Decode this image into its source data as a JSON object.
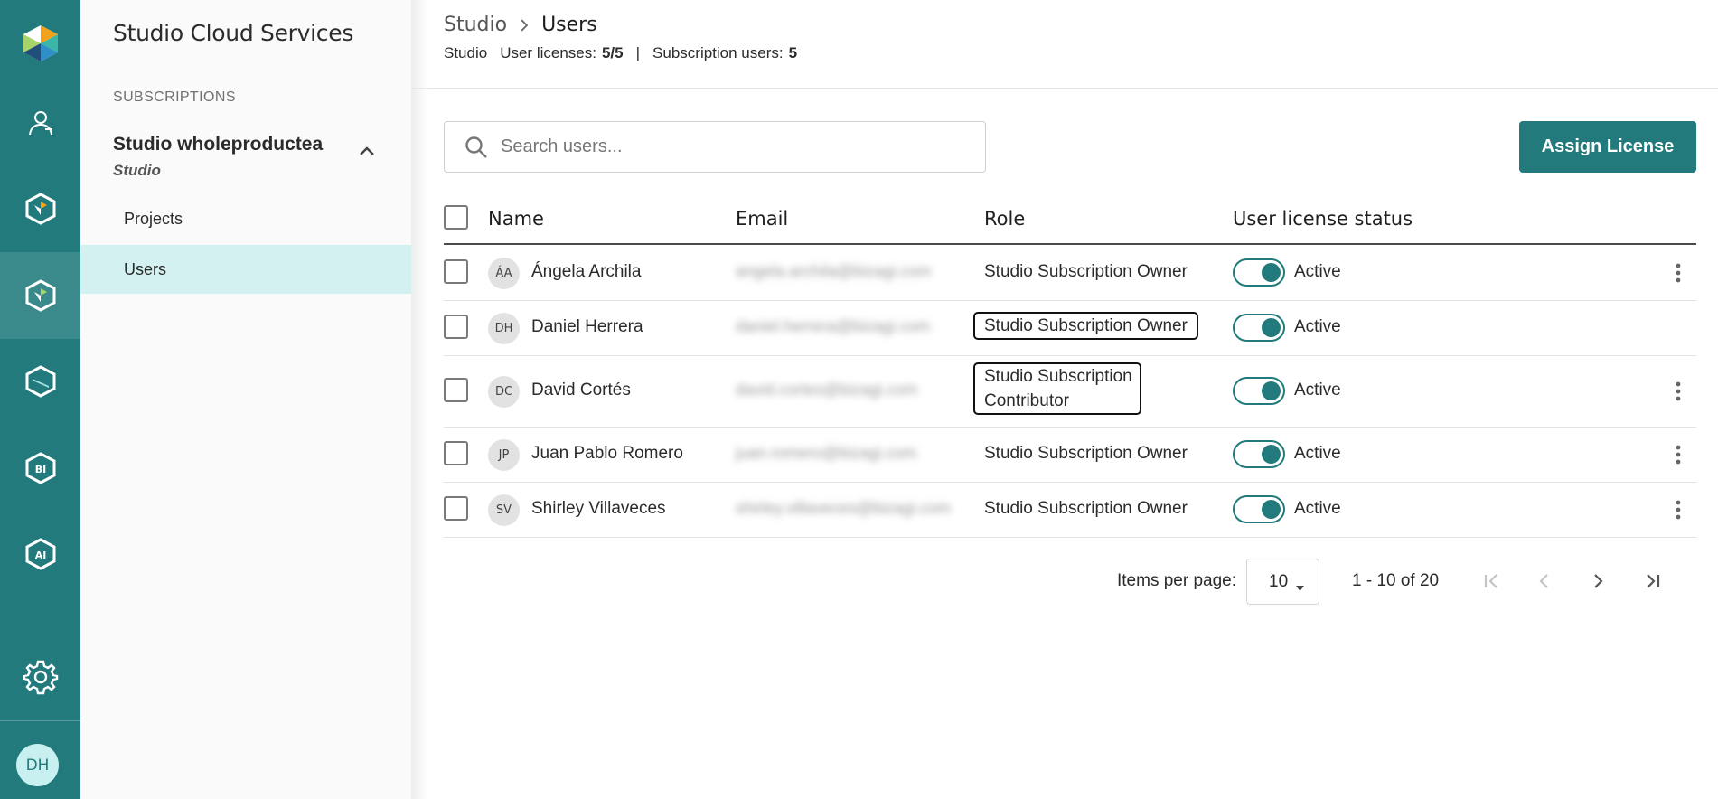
{
  "rail": {
    "items": [
      {
        "name": "studio-logo-icon",
        "label": "Studio logo"
      },
      {
        "name": "users-icon",
        "label": "Users"
      },
      {
        "name": "modeler-icon",
        "label": "Modeler"
      },
      {
        "name": "cloud-services-icon",
        "label": "Cloud services"
      },
      {
        "name": "cube-icon",
        "label": "Cube"
      },
      {
        "name": "bi-icon",
        "label": "BI"
      },
      {
        "name": "ai-icon",
        "label": "AI"
      }
    ],
    "settings_icon": "gear-icon",
    "avatar_initials": "DH"
  },
  "nav": {
    "title": "Studio Cloud Services",
    "section_label": "SUBSCRIPTIONS",
    "subscription_name": "Studio wholeproductea",
    "subscription_type": "Studio",
    "items": [
      {
        "label": "Projects",
        "active": false
      },
      {
        "label": "Users",
        "active": true
      }
    ]
  },
  "header": {
    "breadcrumb": [
      "Studio",
      "Users"
    ],
    "meta": {
      "product": "Studio",
      "licenses_label": "User licenses:",
      "licenses_value": "5/5",
      "separator": "|",
      "subscription_users_label": "Subscription users:",
      "subscription_users_value": "5"
    }
  },
  "toolbar": {
    "search_placeholder": "Search users...",
    "assign_label": "Assign License"
  },
  "table": {
    "columns": [
      "Name",
      "Email",
      "Role",
      "User license status"
    ],
    "rows": [
      {
        "initials": "ÁA",
        "name": "Ángela Archila",
        "email": "angela.archila@bizagi.com",
        "role_line1": "Studio Subscription Owner",
        "role_line2": "",
        "status": "Active",
        "highlighted": false,
        "has_menu": true
      },
      {
        "initials": "DH",
        "name": "Daniel Herrera",
        "email": "daniel.herrera@bizagi.com",
        "role_line1": "Studio Subscription Owner",
        "role_line2": "",
        "status": "Active",
        "highlighted": true,
        "has_menu": false
      },
      {
        "initials": "DC",
        "name": "David Cortés",
        "email": "david.cortes@bizagi.com",
        "role_line1": "Studio Subscription",
        "role_line2": "Contributor",
        "status": "Active",
        "highlighted": true,
        "has_menu": true
      },
      {
        "initials": "JP",
        "name": "Juan Pablo Romero",
        "email": "juan.romero@bizagi.com",
        "role_line1": "Studio Subscription Owner",
        "role_line2": "",
        "status": "Active",
        "highlighted": false,
        "has_menu": true
      },
      {
        "initials": "SV",
        "name": "Shirley Villaveces",
        "email": "shirley.villaveces@bizagi.com",
        "role_line1": "Studio Subscription Owner",
        "role_line2": "",
        "status": "Active",
        "highlighted": false,
        "has_menu": true
      }
    ]
  },
  "paginator": {
    "items_per_page_label": "Items per page:",
    "page_size": "10",
    "range_label": "1 - 10 of 20"
  },
  "colors": {
    "brand": "#237a7c",
    "nav_active": "#d3f1f1"
  }
}
